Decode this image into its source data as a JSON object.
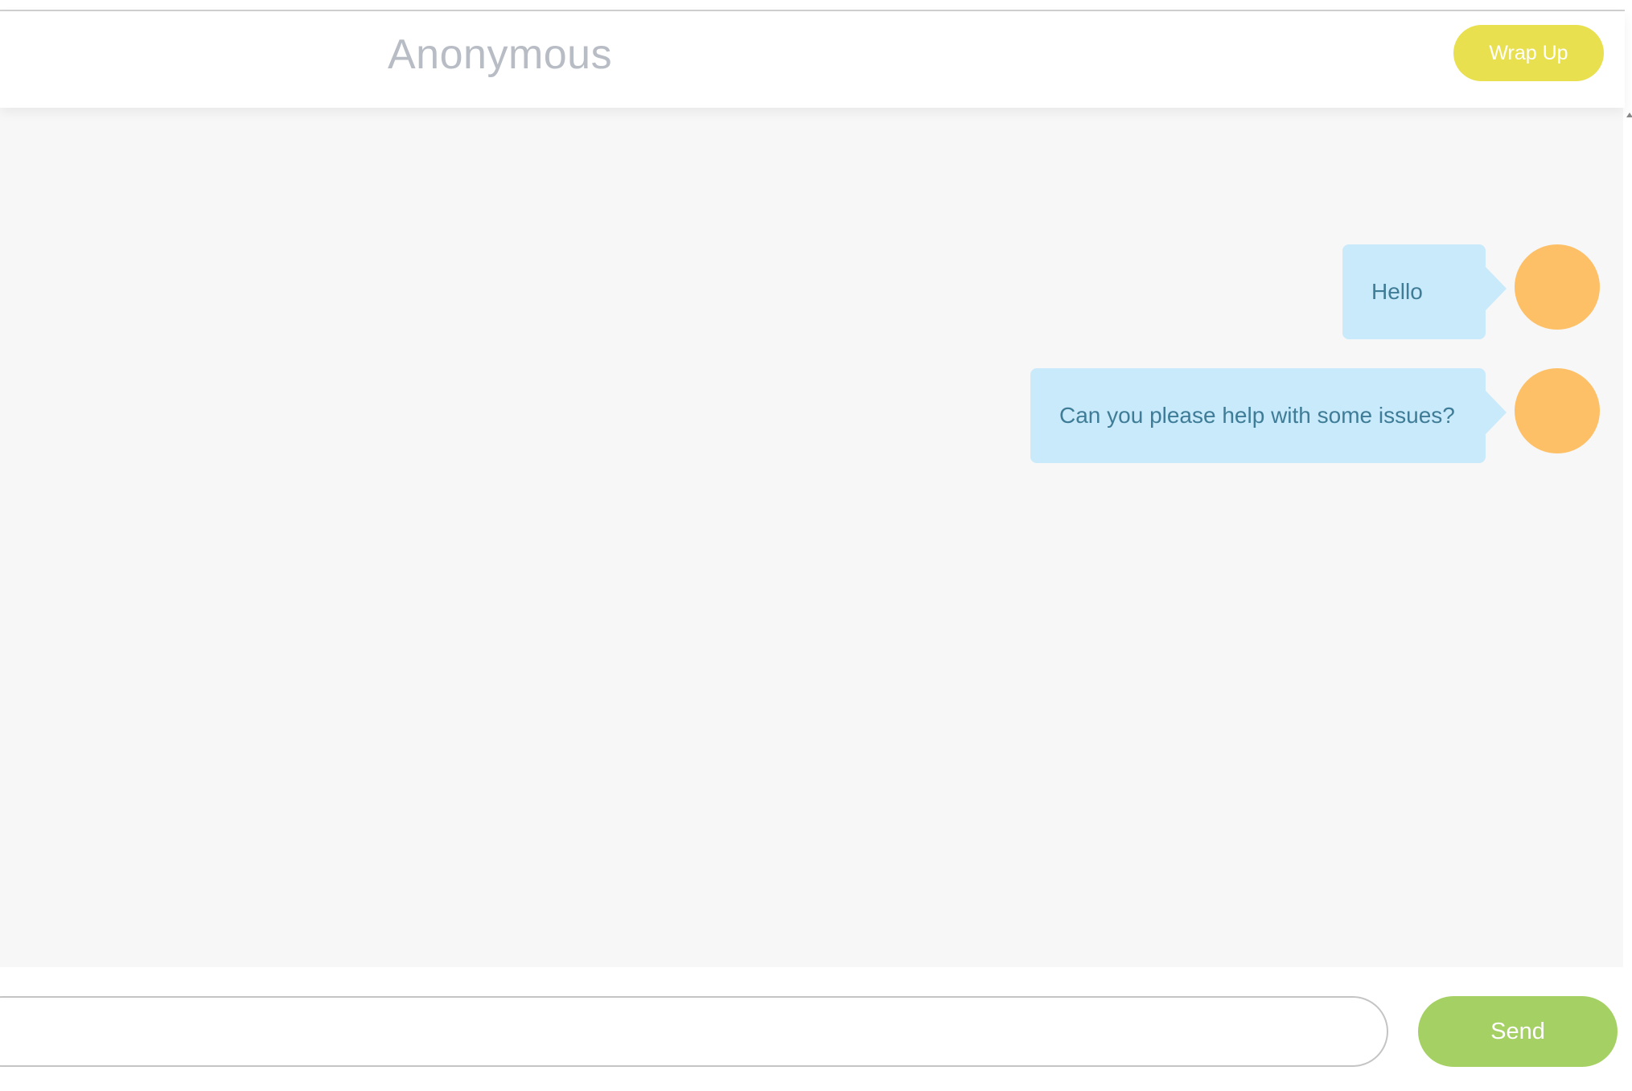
{
  "header": {
    "title": "Anonymous",
    "wrap_up_label": "Wrap Up"
  },
  "messages": [
    {
      "text": "Hello",
      "sender": "user"
    },
    {
      "text": "Can you please help with some issues?",
      "sender": "user"
    }
  ],
  "composer": {
    "input_value": "",
    "input_placeholder": "",
    "send_label": "Send"
  },
  "colors": {
    "wrap_up_button": "#e8e04f",
    "send_button": "#a5d063",
    "bubble": "#c9eafa",
    "bubble_text": "#3e7c97",
    "avatar": "#fdc066",
    "title_text": "#b8bcc4",
    "chat_background": "#f7f7f7"
  }
}
